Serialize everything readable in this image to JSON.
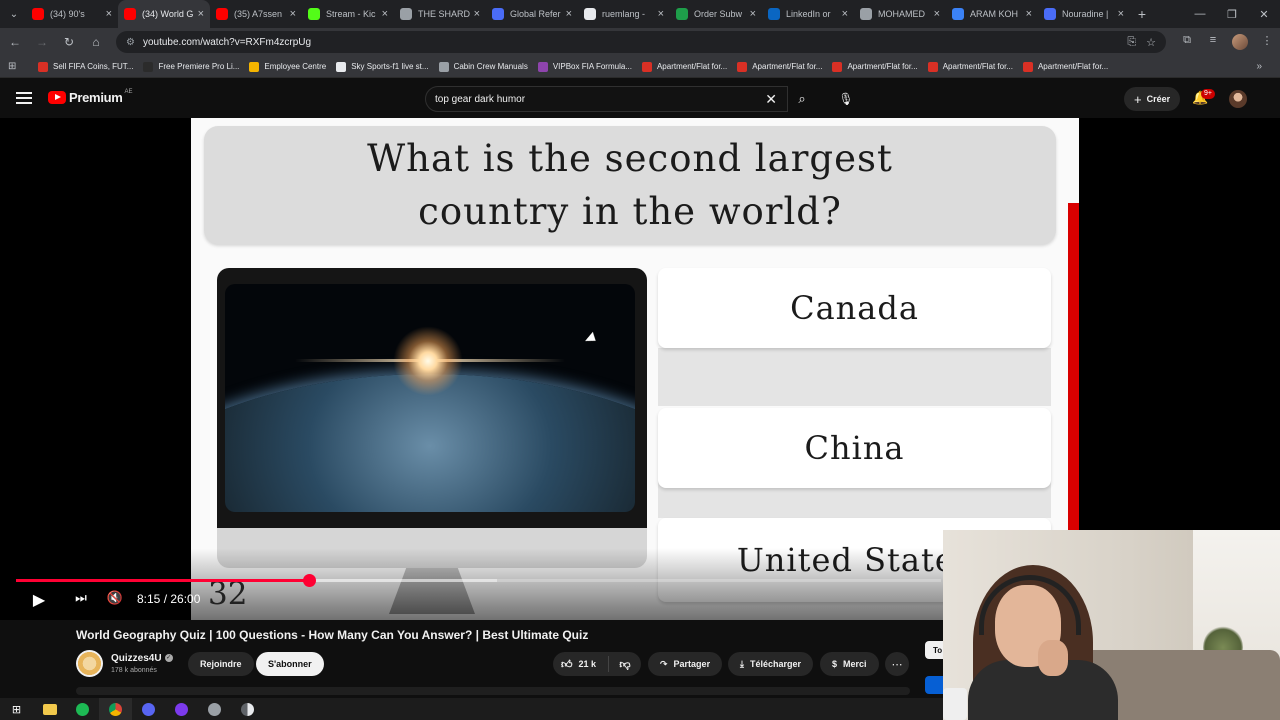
{
  "browser": {
    "tabs": [
      {
        "title": "(34) 90's",
        "color": "#ff0000",
        "active": false
      },
      {
        "title": "(34) World G",
        "color": "#ff0000",
        "active": true
      },
      {
        "title": "(35) A7ssen",
        "color": "#ff0000",
        "active": false
      },
      {
        "title": "Stream - Kic",
        "color": "#53fc18",
        "active": false
      },
      {
        "title": "THE SHARD",
        "color": "#9aa0a6",
        "active": false
      },
      {
        "title": "Global Refer",
        "color": "#4a6cf7",
        "active": false
      },
      {
        "title": "ruemlang - ",
        "color": "#e8eaed",
        "active": false
      },
      {
        "title": "Order Subw",
        "color": "#1e9e4a",
        "active": false
      },
      {
        "title": "LinkedIn or",
        "color": "#0a66c2",
        "active": false
      },
      {
        "title": "MOHAMED",
        "color": "#9aa0a6",
        "active": false
      },
      {
        "title": "ARAM KOH",
        "color": "#3b82f6",
        "active": false
      },
      {
        "title": "Nouradine |",
        "color": "#4a6cf7",
        "active": false
      }
    ],
    "url": "youtube.com/watch?v=RXFm4zcrpUg",
    "bookmarks": [
      {
        "label": "Sell FIFA Coins, FUT...",
        "color": "#d93025"
      },
      {
        "label": "Free Premiere Pro Li...",
        "color": "#2b2b2b"
      },
      {
        "label": "Employee Centre",
        "color": "#f4b400"
      },
      {
        "label": "Sky Sports-f1 live st...",
        "color": "#e8eaed"
      },
      {
        "label": "Cabin Crew Manuals",
        "color": "#9aa0a6"
      },
      {
        "label": "VIPBox FIA Formula...",
        "color": "#8e44ad"
      },
      {
        "label": "Apartment/Flat for...",
        "color": "#d93025"
      },
      {
        "label": "Apartment/Flat for...",
        "color": "#d93025"
      },
      {
        "label": "Apartment/Flat for...",
        "color": "#d93025"
      },
      {
        "label": "Apartment/Flat for...",
        "color": "#d93025"
      },
      {
        "label": "Apartment/Flat for...",
        "color": "#d93025"
      }
    ]
  },
  "youtube": {
    "brand": "Premium",
    "region": "AE",
    "search_query": "top gear dark humor",
    "create_label": "Créer",
    "notification_count": "9+"
  },
  "video": {
    "question": "What is the second largest country in the world?",
    "answers": [
      "Canada",
      "China",
      "United States"
    ],
    "countdown": "32",
    "current_time": "8:15",
    "duration": "26:00",
    "time_display": "8:15 / 26:00",
    "progress_fraction": 0.317,
    "buffered_fraction": 0.52
  },
  "info": {
    "title": "World Geography Quiz | 100 Questions - How Many Can You Answer? | Best Ultimate Quiz",
    "channel": "Quizzes4U",
    "subscribers": "178 k abonnés",
    "join_label": "Rejoindre",
    "subscribe_label": "S'abonner",
    "likes": "21 k",
    "share_label": "Partager",
    "download_label": "Télécharger",
    "thanks_label": "Merci",
    "side_chip": "To"
  }
}
